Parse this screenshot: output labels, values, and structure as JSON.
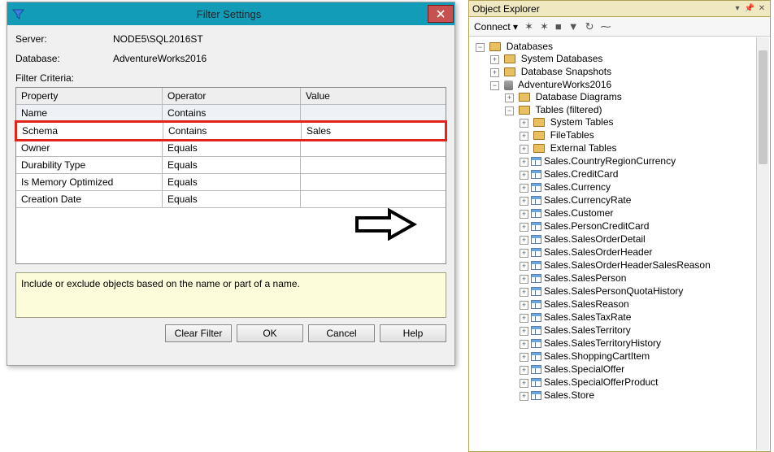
{
  "dialog": {
    "title": "Filter Settings",
    "server_label": "Server:",
    "server_value": "NODE5\\SQL2016ST",
    "database_label": "Database:",
    "database_value": "AdventureWorks2016",
    "criteria_label": "Filter Criteria:",
    "columns": {
      "property": "Property",
      "operator": "Operator",
      "value": "Value"
    },
    "rows": [
      {
        "property": "Name",
        "operator": "Contains",
        "value": ""
      },
      {
        "property": "Schema",
        "operator": "Contains",
        "value": "Sales"
      },
      {
        "property": "Owner",
        "operator": "Equals",
        "value": ""
      },
      {
        "property": "Durability Type",
        "operator": "Equals",
        "value": ""
      },
      {
        "property": "Is Memory Optimized",
        "operator": "Equals",
        "value": ""
      },
      {
        "property": "Creation Date",
        "operator": "Equals",
        "value": ""
      }
    ],
    "hint": "Include or exclude objects based on the name or part of a name.",
    "buttons": {
      "clear": "Clear Filter",
      "ok": "OK",
      "cancel": "Cancel",
      "help": "Help"
    }
  },
  "explorer": {
    "title": "Object Explorer",
    "connect_label": "Connect ▾",
    "tree": {
      "databases": "Databases",
      "system_db": "System Databases",
      "snapshots": "Database Snapshots",
      "db_name": "AdventureWorks2016",
      "diagrams": "Database Diagrams",
      "tables_filtered": "Tables (filtered)",
      "sys_tables": "System Tables",
      "file_tables": "FileTables",
      "ext_tables": "External Tables",
      "tables": [
        "Sales.CountryRegionCurrency",
        "Sales.CreditCard",
        "Sales.Currency",
        "Sales.CurrencyRate",
        "Sales.Customer",
        "Sales.PersonCreditCard",
        "Sales.SalesOrderDetail",
        "Sales.SalesOrderHeader",
        "Sales.SalesOrderHeaderSalesReason",
        "Sales.SalesPerson",
        "Sales.SalesPersonQuotaHistory",
        "Sales.SalesReason",
        "Sales.SalesTaxRate",
        "Sales.SalesTerritory",
        "Sales.SalesTerritoryHistory",
        "Sales.ShoppingCartItem",
        "Sales.SpecialOffer",
        "Sales.SpecialOfferProduct",
        "Sales.Store"
      ]
    }
  }
}
